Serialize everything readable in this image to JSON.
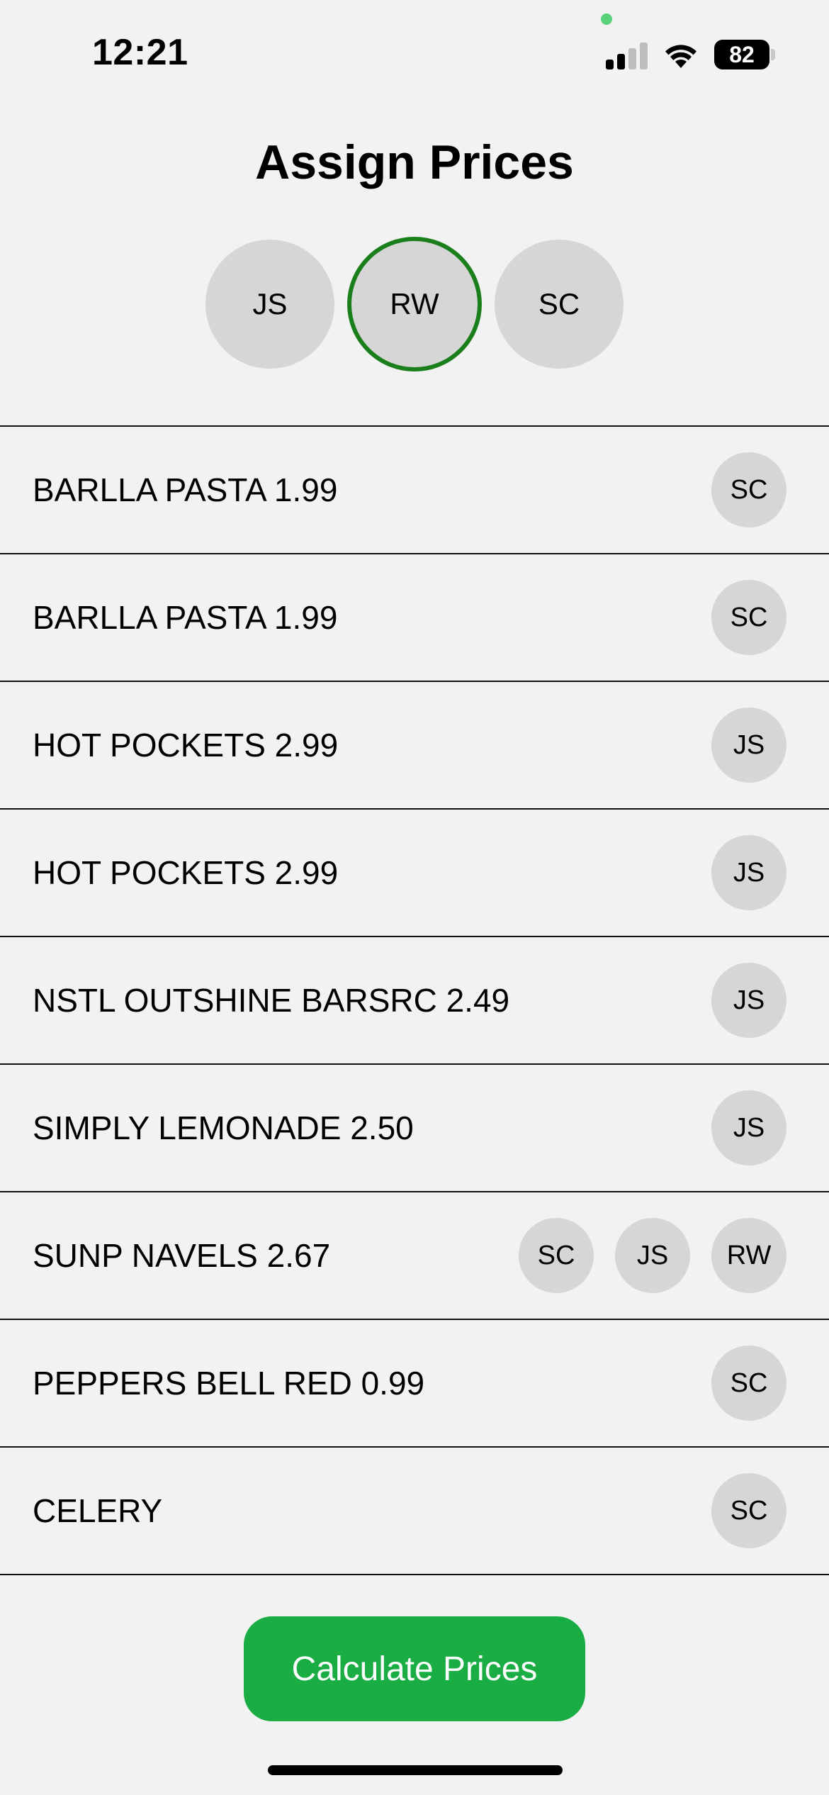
{
  "status_bar": {
    "time": "12:21",
    "battery": "82",
    "icons": [
      "signal-icon",
      "wifi-icon",
      "battery-icon"
    ]
  },
  "title": "Assign Prices",
  "people": [
    {
      "initials": "JS",
      "selected": false
    },
    {
      "initials": "RW",
      "selected": true
    },
    {
      "initials": "SC",
      "selected": false
    }
  ],
  "items": [
    {
      "label": "BARLLA PASTA 1.99",
      "assigned": [
        "SC"
      ]
    },
    {
      "label": "BARLLA PASTA 1.99",
      "assigned": [
        "SC"
      ]
    },
    {
      "label": "HOT POCKETS 2.99",
      "assigned": [
        "JS"
      ]
    },
    {
      "label": "HOT POCKETS 2.99",
      "assigned": [
        "JS"
      ]
    },
    {
      "label": "NSTL OUTSHINE BARSRC 2.49",
      "assigned": [
        "JS"
      ]
    },
    {
      "label": "SIMPLY LEMONADE 2.50",
      "assigned": [
        "JS"
      ]
    },
    {
      "label": "SUNP NAVELS 2.67",
      "assigned": [
        "SC",
        "JS",
        "RW"
      ]
    },
    {
      "label": "PEPPERS BELL RED 0.99",
      "assigned": [
        "SC"
      ]
    },
    {
      "label": "CELERY",
      "assigned": [
        "SC"
      ]
    }
  ],
  "calculate_label": "Calculate Prices",
  "colors": {
    "accent": "#1aad44",
    "selected_ring": "#1a7f1a",
    "avatar_bg": "#d6d6d6",
    "background": "#f2f2f2"
  }
}
